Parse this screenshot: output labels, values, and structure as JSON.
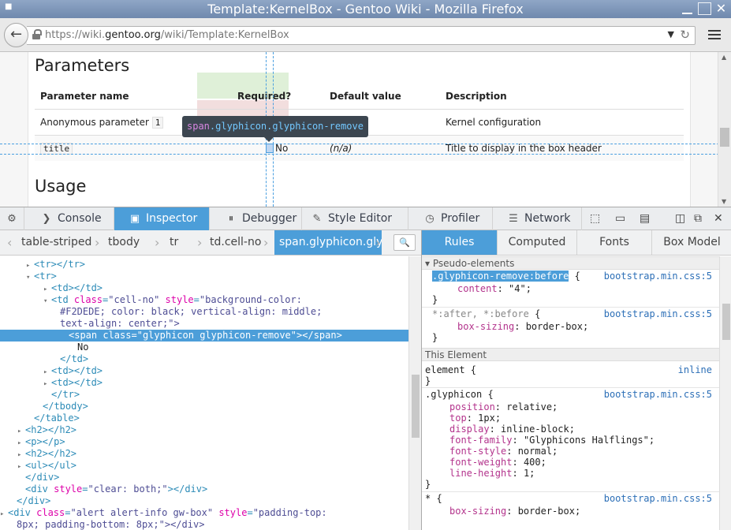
{
  "window": {
    "title": "Template:KernelBox - Gentoo Wiki - Mozilla Firefox"
  },
  "nav": {
    "url_prefix": "https://wiki.",
    "url_domain": "gentoo.org",
    "url_suffix": "/wiki/Template:KernelBox"
  },
  "page": {
    "heading_parameters": "Parameters",
    "heading_usage": "Usage",
    "table": {
      "headers": [
        "Parameter name",
        "Required?",
        "Default value",
        "Description"
      ],
      "row1": {
        "name": "Anonymous parameter",
        "index": "1",
        "description": "Kernel configuration"
      },
      "row2": {
        "name": "title",
        "required": "No",
        "default": "(n/a)",
        "description": "Title to display in the box header"
      }
    },
    "tooltip": {
      "tag": "span",
      "classes": ".glyphicon.glyphicon-remove"
    }
  },
  "devtools": {
    "tabs": [
      "Console",
      "Inspector",
      "Debugger",
      "Style Editor",
      "Profiler",
      "Network"
    ],
    "breadcrumbs": [
      "table-striped",
      "tbody",
      "tr",
      "td.cell-no",
      "span.glyphicon.gly"
    ],
    "markup": [
      {
        "indent": 9,
        "tw": "▸",
        "tag": "<tr></tr>"
      },
      {
        "indent": 9,
        "tw": "▾",
        "tag": "<tr>"
      },
      {
        "indent": 11,
        "tw": "▸",
        "tag": "<td></td>"
      },
      {
        "indent": 11,
        "tw": "▾",
        "tag": "<td ",
        "a1": "class",
        "v1": "\"cell-no\"",
        "a2": " style",
        "v2": "\"background-color:"
      },
      {
        "indent": 12,
        "tw": "",
        "text": "#F2DEDE; color: black; vertical-align: middle;"
      },
      {
        "indent": 12,
        "tw": "",
        "text": "text-align: center;\">"
      },
      {
        "indent": 13,
        "tw": "",
        "tag": "<span ",
        "a1": "class",
        "v1": "\"glyphicon glyphicon-remove\"",
        "tail": "></span>",
        "sel": true
      },
      {
        "indent": 14,
        "tw": "",
        "plain": "No"
      },
      {
        "indent": 12,
        "tw": "",
        "tag": "</td>"
      },
      {
        "indent": 11,
        "tw": "▸",
        "tag": "<td></td>"
      },
      {
        "indent": 11,
        "tw": "▸",
        "tag": "<td></td>"
      },
      {
        "indent": 11,
        "tw": "",
        "tag": "</tr>"
      },
      {
        "indent": 10,
        "tw": "",
        "tag": "</tbody>"
      },
      {
        "indent": 9,
        "tw": "",
        "tag": "</table>"
      },
      {
        "indent": 8,
        "tw": "▸",
        "tag": "<h2></h2>"
      },
      {
        "indent": 8,
        "tw": "▸",
        "tag": "<p></p>"
      },
      {
        "indent": 8,
        "tw": "▸",
        "tag": "<h2></h2>"
      },
      {
        "indent": 8,
        "tw": "▸",
        "tag": "<ul></ul>"
      },
      {
        "indent": 8,
        "tw": "",
        "tag": "</div>"
      },
      {
        "indent": 8,
        "tw": "",
        "tag": "<div ",
        "a1": "style",
        "v1": "\"clear: both;\"",
        "tail": "></div>"
      },
      {
        "indent": 7,
        "tw": "",
        "tag": "</div>"
      },
      {
        "indent": 6,
        "tw": "▸",
        "tag": "<div ",
        "a1": "class",
        "v1": "\"alert alert-info gw-box\"",
        "a2": " style",
        "v2": "\"padding-top:"
      },
      {
        "indent": 7,
        "tw": "",
        "text": "8px; padding-bottom: 8px;\"></div>"
      }
    ],
    "rules_tabs": [
      "Rules",
      "Computed",
      "Fonts",
      "Box Model"
    ],
    "rules": {
      "pseudo_header": "Pseudo-elements",
      "this_element_header": "This Element",
      "r1_selector": ".glyphicon-remove:before",
      "r1_src": "bootstrap.min.css:5",
      "r1_prop": "content",
      "r1_val": "\"4\";",
      "r2_selector": "*:after, *:before",
      "r2_src": "bootstrap.min.css:5",
      "r2_prop": "box-sizing",
      "r2_val": "border-box;",
      "r3_selector": "element",
      "r3_src": "inline",
      "r4_selector": ".glyphicon",
      "r4_src": "bootstrap.min.css:5",
      "r4_props": [
        {
          "p": "position",
          "v": "relative;"
        },
        {
          "p": "top",
          "v": "1px;"
        },
        {
          "p": "display",
          "v": "inline-block;"
        },
        {
          "p": "font-family",
          "v": "\"Glyphicons Halflings\";"
        },
        {
          "p": "font-style",
          "v": "normal;"
        },
        {
          "p": "font-weight",
          "v": "400;"
        },
        {
          "p": "line-height",
          "v": "1;"
        }
      ],
      "r5_selector": "*",
      "r5_src": "bootstrap.min.css:5",
      "r5_prop": "box-sizing",
      "r5_val": "border-box;"
    }
  }
}
